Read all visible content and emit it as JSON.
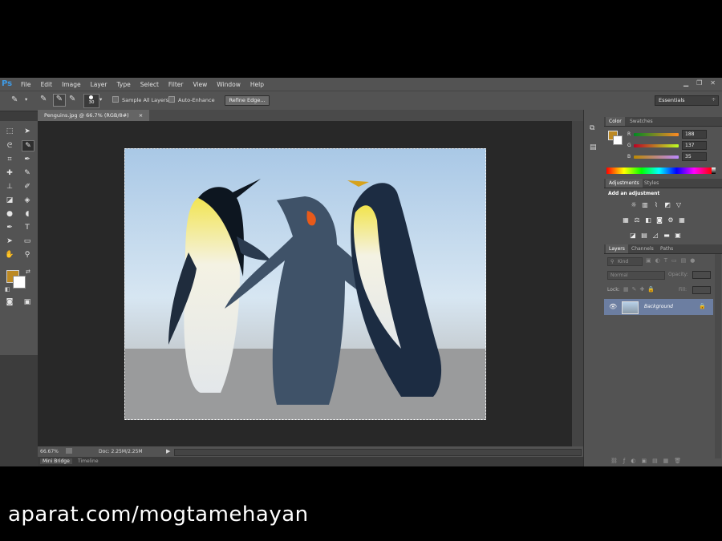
{
  "app": {
    "logo": "Ps",
    "menu": [
      "File",
      "Edit",
      "Image",
      "Layer",
      "Type",
      "Select",
      "Filter",
      "View",
      "Window",
      "Help"
    ],
    "window_controls": [
      "▁",
      "❐",
      "✕"
    ]
  },
  "options_bar": {
    "brush_size": "30",
    "sample_all_layers": "Sample All Layers",
    "auto_enhance": "Auto-Enhance",
    "refine_edge": "Refine Edge...",
    "workspace": "Essentials"
  },
  "document": {
    "tab_title": "Penguins.jpg @ 66.7% (RGB/8#)",
    "close": "×"
  },
  "status_bar": {
    "zoom": "66.67%",
    "doc_info": "Doc: 2.25M/2.25M"
  },
  "bottom_tabs": [
    "Mini Bridge",
    "Timeline"
  ],
  "color_panel": {
    "tabs": [
      "Color",
      "Swatches"
    ],
    "channels": [
      {
        "label": "R",
        "value": "188"
      },
      {
        "label": "G",
        "value": "137"
      },
      {
        "label": "B",
        "value": "35"
      }
    ],
    "foreground": "#bc8923"
  },
  "adjustments_panel": {
    "tabs": [
      "Adjustments",
      "Styles"
    ],
    "heading": "Add an adjustment"
  },
  "layers_panel": {
    "tabs": [
      "Layers",
      "Channels",
      "Paths"
    ],
    "kind": "Kind",
    "blend_mode": "Normal",
    "opacity_label": "Opacity:",
    "lock_label": "Lock:",
    "fill_label": "Fill:",
    "layer_name": "Background"
  },
  "watermark": "aparat.com/mogtamehayan"
}
